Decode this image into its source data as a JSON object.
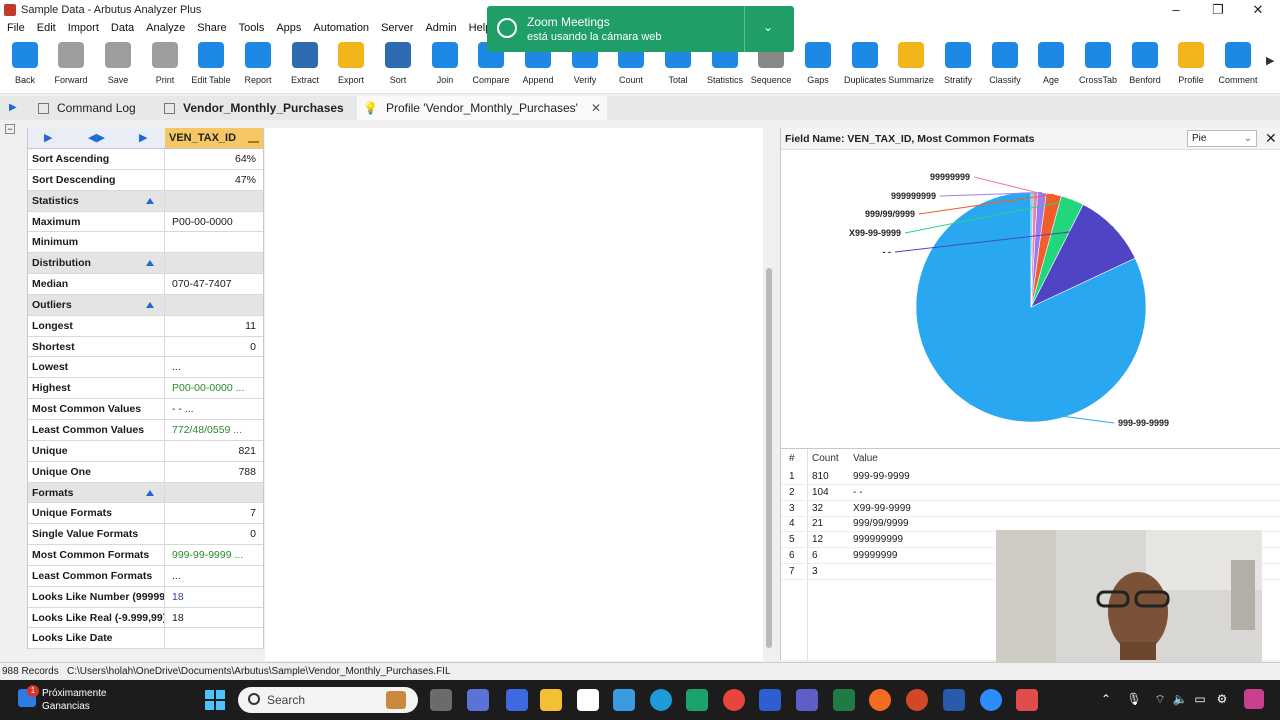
{
  "window": {
    "title": "Sample Data - Arbutus Analyzer Plus"
  },
  "menu": [
    "File",
    "Edit",
    "Import",
    "Data",
    "Analyze",
    "Share",
    "Tools",
    "Apps",
    "Automation",
    "Server",
    "Admin",
    "Help"
  ],
  "toolbar": [
    {
      "label": "Back",
      "icon": "arrow-left-icon",
      "color": "#1e88e5"
    },
    {
      "label": "Forward",
      "icon": "arrow-right-icon",
      "color": "#9e9e9e"
    },
    {
      "label": "Save",
      "icon": "save-icon",
      "color": "#9e9e9e"
    },
    {
      "label": "Print",
      "icon": "print-icon",
      "color": "#9e9e9e"
    },
    {
      "label": "Edit Table",
      "icon": "edit-table-icon",
      "color": "#1e88e5"
    },
    {
      "label": "Report",
      "icon": "report-icon",
      "color": "#1e88e5"
    },
    {
      "label": "Extract",
      "icon": "extract-icon",
      "color": "#2f6bb0"
    },
    {
      "label": "Export",
      "icon": "export-icon",
      "color": "#f2b51b"
    },
    {
      "label": "Sort",
      "icon": "sort-icon",
      "color": "#2f6bb0"
    },
    {
      "label": "Join",
      "icon": "join-icon",
      "color": "#1e88e5"
    },
    {
      "label": "Compare",
      "icon": "compare-icon",
      "color": "#1e88e5"
    },
    {
      "label": "Append",
      "icon": "append-icon",
      "color": "#1e88e5"
    },
    {
      "label": "Verify",
      "icon": "verify-icon",
      "color": "#1e88e5"
    },
    {
      "label": "Count",
      "icon": "count-icon",
      "color": "#1e88e5"
    },
    {
      "label": "Total",
      "icon": "total-icon",
      "color": "#1e88e5"
    },
    {
      "label": "Statistics",
      "icon": "statistics-icon",
      "color": "#1e88e5"
    },
    {
      "label": "Sequence",
      "icon": "sequence-icon",
      "color": "#888888"
    },
    {
      "label": "Gaps",
      "icon": "gaps-icon",
      "color": "#1e88e5"
    },
    {
      "label": "Duplicates",
      "icon": "duplicates-icon",
      "color": "#1e88e5"
    },
    {
      "label": "Summarize",
      "icon": "summarize-icon",
      "color": "#f2b51b"
    },
    {
      "label": "Stratify",
      "icon": "stratify-icon",
      "color": "#1e88e5"
    },
    {
      "label": "Classify",
      "icon": "classify-icon",
      "color": "#1e88e5"
    },
    {
      "label": "Age",
      "icon": "age-icon",
      "color": "#1e88e5"
    },
    {
      "label": "CrossTab",
      "icon": "crosstab-icon",
      "color": "#1e88e5"
    },
    {
      "label": "Benford",
      "icon": "benford-icon",
      "color": "#1e88e5"
    },
    {
      "label": "Profile",
      "icon": "profile-icon",
      "color": "#f2b51b"
    },
    {
      "label": "Comment",
      "icon": "comment-icon",
      "color": "#1e88e5"
    }
  ],
  "notification": {
    "title": "Zoom Meetings",
    "body": "está usando la cámara web"
  },
  "tabs": [
    {
      "label": "Command Log"
    },
    {
      "label": "Vendor_Monthly_Purchases"
    },
    {
      "label": "Profile 'Vendor_Monthly_Purchases'"
    }
  ],
  "profile": {
    "column": "VEN_TAX_ID",
    "rows": [
      {
        "k": "Sort Ascending",
        "v": "64%",
        "style": "num"
      },
      {
        "k": "Sort Descending",
        "v": "47%",
        "style": "num"
      },
      {
        "k": "Statistics",
        "v": "",
        "section": true
      },
      {
        "k": "Maximum",
        "v": "P00-00-0000",
        "style": ""
      },
      {
        "k": "Minimum",
        "v": "",
        "style": ""
      },
      {
        "k": "Distribution",
        "v": "",
        "section": true
      },
      {
        "k": "Median",
        "v": "070-47-7407",
        "style": ""
      },
      {
        "k": "Outliers",
        "v": "",
        "section": true
      },
      {
        "k": "Longest",
        "v": "11",
        "style": "num"
      },
      {
        "k": "Shortest",
        "v": "0",
        "style": "num"
      },
      {
        "k": "Lowest",
        "v": "  ...",
        "style": ""
      },
      {
        "k": "Highest",
        "v": "P00-00-0000  ...",
        "style": "green"
      },
      {
        "k": "Most Common Values",
        "v": "-  -  ...",
        "style": ""
      },
      {
        "k": "Least Common Values",
        "v": "772/48/0559  ...",
        "style": "green"
      },
      {
        "k": "Unique",
        "v": "821",
        "style": "num"
      },
      {
        "k": "Unique One",
        "v": "788",
        "style": "num"
      },
      {
        "k": "Formats",
        "v": "",
        "section": true
      },
      {
        "k": "Unique Formats",
        "v": "7",
        "style": "num"
      },
      {
        "k": "Single Value Formats",
        "v": "0",
        "style": "num"
      },
      {
        "k": "Most Common Formats",
        "v": "999-99-9999  ...",
        "style": "green"
      },
      {
        "k": "Least Common Formats",
        "v": "  ...",
        "style": ""
      },
      {
        "k": "Looks Like Number (99999)",
        "v": "18",
        "style": "blue"
      },
      {
        "k": "Looks Like Real (-9.999,99)",
        "v": "18",
        "style": ""
      },
      {
        "k": "Looks Like Date",
        "v": "",
        "style": ""
      }
    ]
  },
  "right_panel": {
    "field_name": "Field Name: VEN_TAX_ID, Most Common Formats",
    "chart_selector": "Pie"
  },
  "chart_data": {
    "type": "pie",
    "title": "",
    "categories": [
      "999-99-9999",
      "- -",
      "X99-99-9999",
      "999/99/9999",
      "999999999",
      "99999999",
      ""
    ],
    "values": [
      810,
      104,
      32,
      21,
      12,
      6,
      3
    ],
    "labels_shown": [
      "999-99-9999",
      "- -",
      "X99-99-9999",
      "999/99/9999",
      "999999999",
      "99999999"
    ],
    "colors": [
      "#29a8f1",
      "#4e44c4",
      "#22d67d",
      "#f25e2b",
      "#9b7cf0",
      "#f27bb0",
      "#4cd7d7"
    ],
    "legend": "none"
  },
  "format_table": {
    "headers": [
      "#",
      "Count",
      "Value"
    ],
    "rows": [
      {
        "n": "1",
        "count": "810",
        "value": "999-99-9999"
      },
      {
        "n": "2",
        "count": "104",
        "value": "-  -"
      },
      {
        "n": "3",
        "count": "32",
        "value": "X99-99-9999"
      },
      {
        "n": "4",
        "count": "21",
        "value": "999/99/9999"
      },
      {
        "n": "5",
        "count": "12",
        "value": "999999999"
      },
      {
        "n": "6",
        "count": "6",
        "value": "99999999"
      },
      {
        "n": "7",
        "count": "3",
        "value": ""
      }
    ]
  },
  "status": {
    "records": "988 Records",
    "path": "C:\\Users\\holah\\OneDrive\\Documents\\Arbutus\\Sample\\Vendor_Monthly_Purchases.FIL"
  },
  "taskbar": {
    "weather_line1": "Próximamente",
    "weather_line2": "Ganancias",
    "weather_badge": "1",
    "search_placeholder": "Search"
  }
}
